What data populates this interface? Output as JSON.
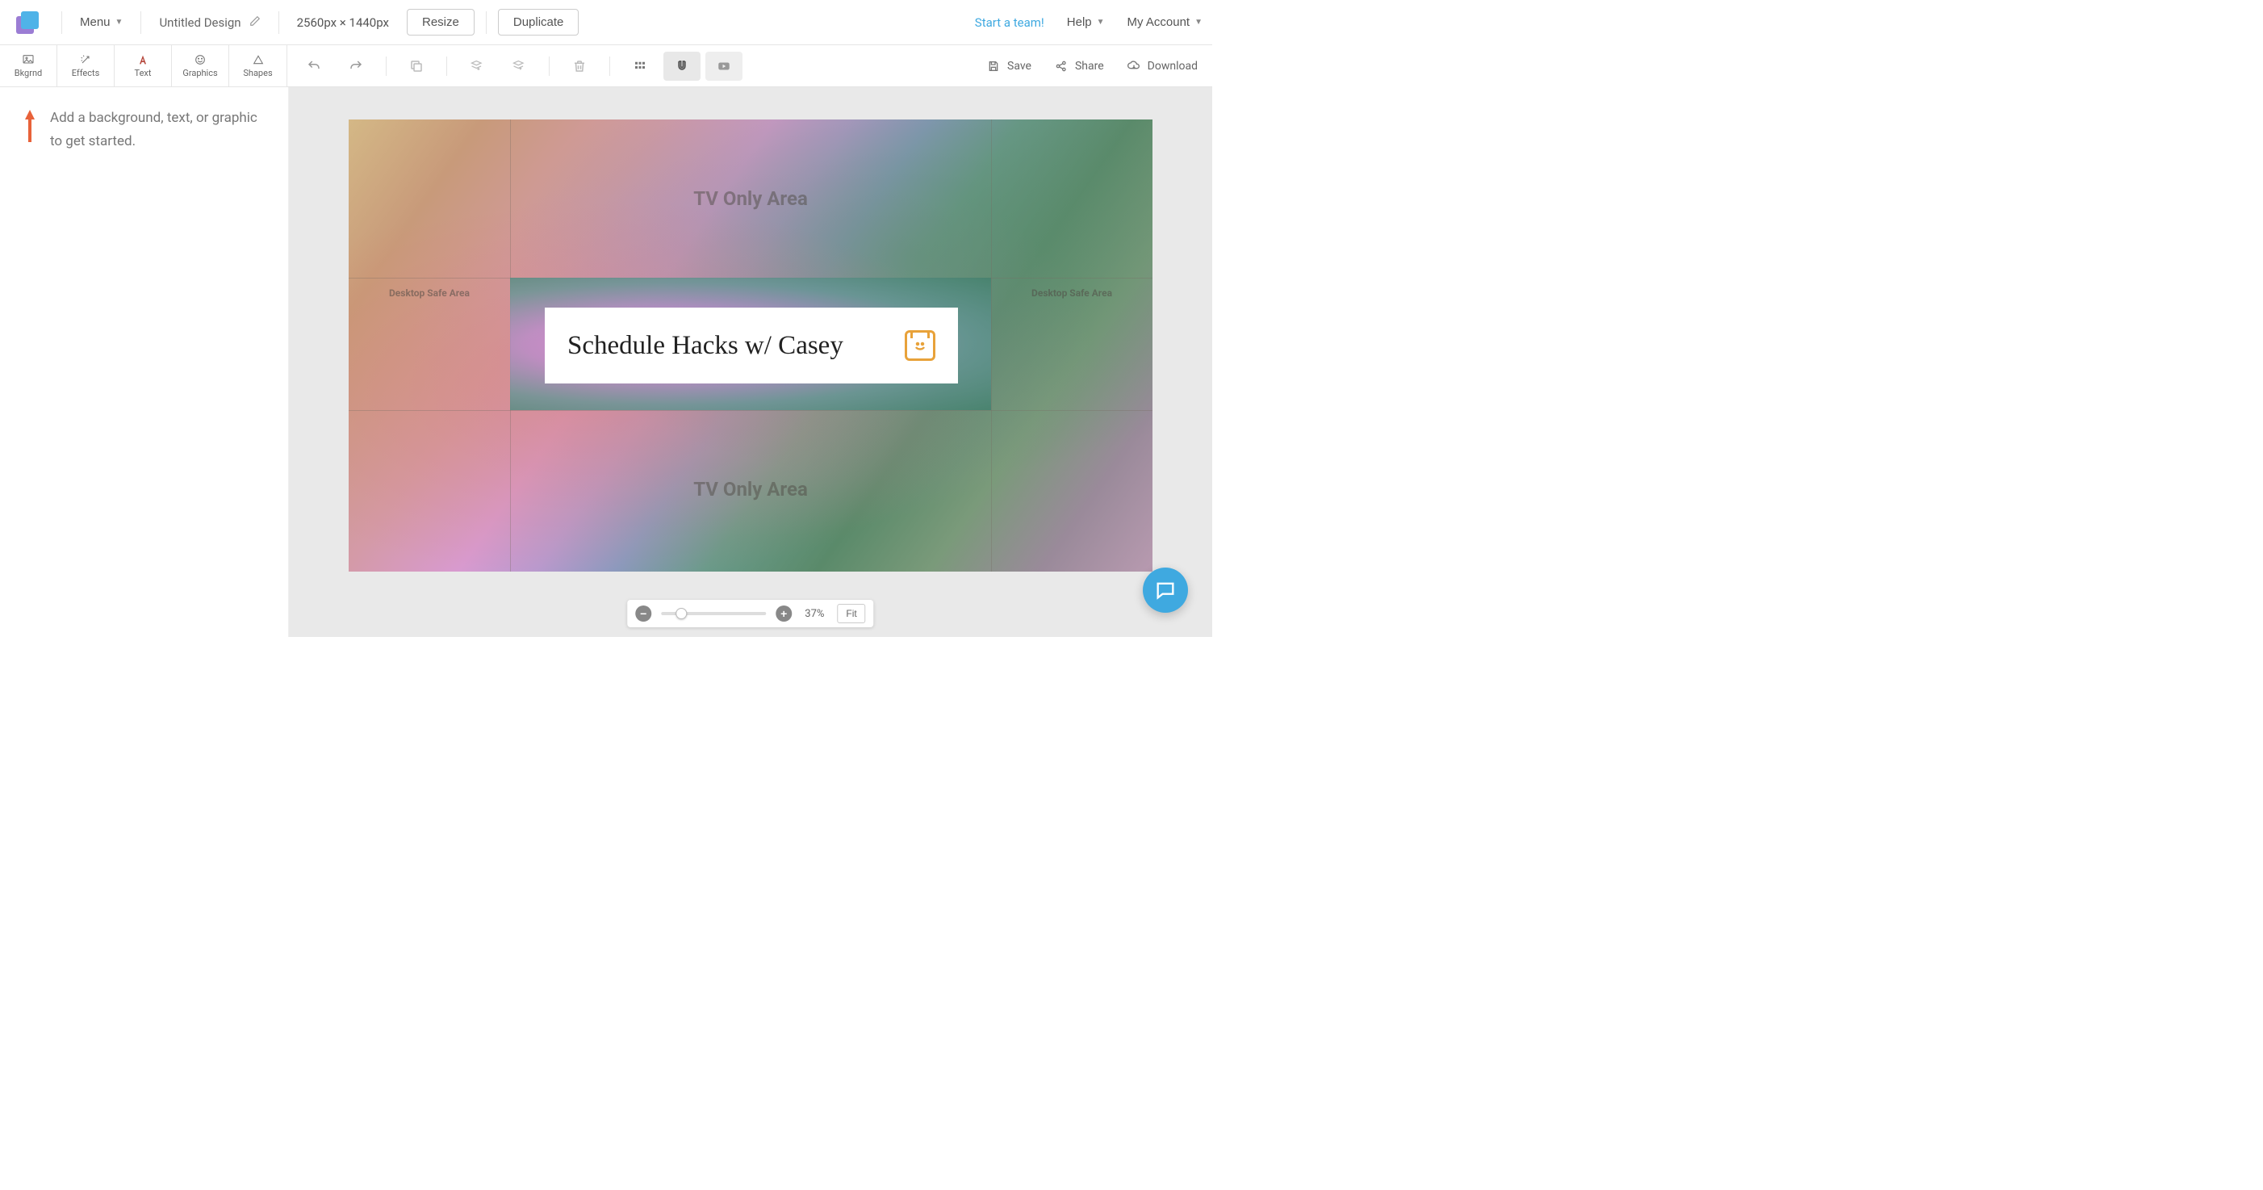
{
  "header": {
    "menu_label": "Menu",
    "design_title": "Untitled Design",
    "dimensions": "2560px × 1440px",
    "resize_label": "Resize",
    "duplicate_label": "Duplicate",
    "start_team_label": "Start a team!",
    "help_label": "Help",
    "account_label": "My Account"
  },
  "tool_tabs": {
    "bkgrnd": "Bkgrnd",
    "effects": "Effects",
    "text": "Text",
    "graphics": "Graphics",
    "shapes": "Shapes"
  },
  "actions": {
    "save": "Save",
    "share": "Share",
    "download": "Download"
  },
  "sidebar": {
    "hint_text": "Add a background, text, or graphic to get started."
  },
  "canvas": {
    "tv_only_label_top": "TV Only Area",
    "tv_only_label_bottom": "TV Only Area",
    "desktop_safe_left": "Desktop Safe Area",
    "desktop_safe_right": "Desktop Safe Area",
    "title_text": "Schedule Hacks w/ Casey"
  },
  "zoom": {
    "percent": "37%",
    "fit_label": "Fit"
  }
}
